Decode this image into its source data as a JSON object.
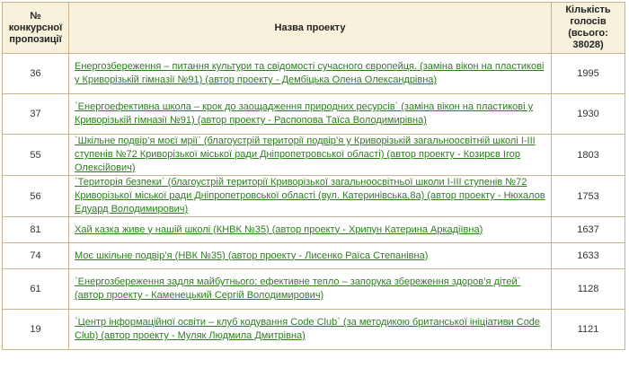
{
  "table": {
    "headers": {
      "number": "№ конкурсної пропозиції",
      "project": "Назва проекту",
      "votes": "Кількість голосів (всього: 38028)"
    },
    "rows": [
      {
        "num": "36",
        "title": "Енергозбереження – питання культури та свідомості сучасного європейця. (заміна вікон на пластикові у Криворізькій гімназії №91) (автор проекту - Дембіцька Олена Олександрівна)",
        "votes": "1995"
      },
      {
        "num": "37",
        "title": "`Енергоефективна школа – крок до заощадження природних ресурсів` (заміна вікон на пластикові у Криворізькій гімназії №91) (автор проекту - Распопова Таїса Володимирівна)",
        "votes": "1930"
      },
      {
        "num": "55",
        "title": "`Шкільне подвір’я моєї мрії` (благоустрій території подвір’я у Криворізькій загальноосвітній школі І-ІІІ ступенів №72 Криворізької міської ради Дніпропетровської області) (автор проекту - Козирєв Ігор Олексійович)",
        "votes": "1803"
      },
      {
        "num": "56",
        "title": "`Територія безпеки` (благоустрій території Криворізької загальноосвітньої школи І-ІІІ ступенів №72 Криворізької міської ради Дніпропетровської області (вул. Катеринівська,8а) (автор проекту - Нюхалов Едуард Володимирович)",
        "votes": "1753"
      },
      {
        "num": "81",
        "title": "Хай казка живе у нашій школі (КНВК №35) (автор проекту - Хрипун Катерина Аркадіївна)",
        "votes": "1637"
      },
      {
        "num": "74",
        "title": "Моє шкільне подвір’я (НВК №35) (автор проекту - Лисенко Раїса Степанівна)",
        "votes": "1633"
      },
      {
        "num": "61",
        "title": "`Енергозбереження задля майбутнього: ефективне тепло – запорука збереження здоров’я дітей` (автор проекту - Каменецький Сергій Володимирович)",
        "votes": "1128"
      },
      {
        "num": "19",
        "title": "`Центр інформаційної освіти – клуб кодування Code Club` (за методикою британської ініціативи Code Club) (автор проекту - Муляк Людмила Дмитрівна)",
        "votes": "1121"
      }
    ]
  }
}
